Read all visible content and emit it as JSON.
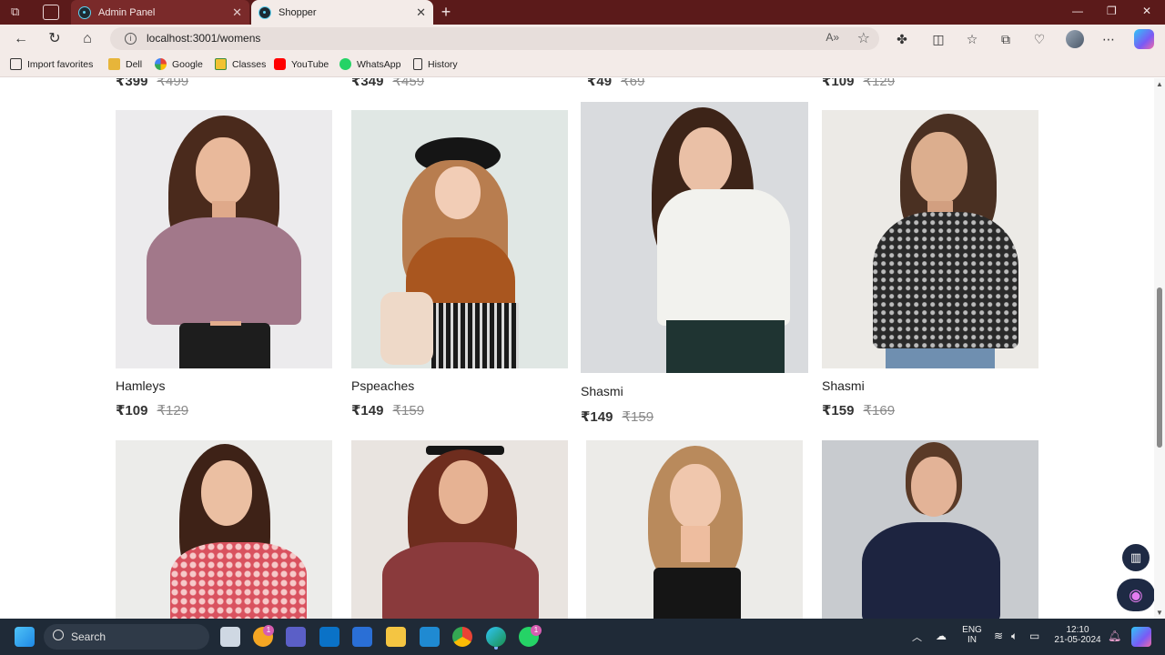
{
  "browser": {
    "tabs": [
      {
        "title": "Admin Panel",
        "active": false
      },
      {
        "title": "Shopper",
        "active": true
      }
    ],
    "url": "localhost:3001/womens",
    "favorites": [
      "Import favorites",
      "Dell",
      "Google",
      "Classes",
      "YouTube",
      "WhatsApp",
      "History"
    ]
  },
  "previous_row_prices": [
    {
      "new": "₹399",
      "old": "₹499"
    },
    {
      "new": "₹349",
      "old": "₹459"
    },
    {
      "new": "₹49",
      "old": "₹69"
    },
    {
      "new": "₹109",
      "old": "₹129"
    }
  ],
  "products": [
    {
      "name": "Hamleys",
      "new_price": "₹109",
      "old_price": "₹129"
    },
    {
      "name": "Pspeaches",
      "new_price": "₹149",
      "old_price": "₹159"
    },
    {
      "name": "Shasmi",
      "new_price": "₹149",
      "old_price": "₹159"
    },
    {
      "name": "Shasmi",
      "new_price": "₹159",
      "old_price": "₹169"
    }
  ],
  "taskbar": {
    "search_label": "Search",
    "lang_top": "ENG",
    "lang_bottom": "IN",
    "time": "12:10",
    "date": "21-05-2024",
    "notifications_badge": "1",
    "whatsapp_badge": "1"
  },
  "colors": {
    "titlebar": "#5b1a1a",
    "toolbar": "#f3ebe8",
    "taskbar": "#1f2a37"
  },
  "icons": [
    "workspaces-icon",
    "tab-actions-icon",
    "back-icon",
    "refresh-icon",
    "home-icon",
    "info-icon",
    "read-aloud-icon",
    "favorite-star-icon",
    "extensions-icon",
    "split-screen-icon",
    "favorites-icon",
    "collections-icon",
    "performance-icon",
    "menu-icon",
    "copilot-icon",
    "reading-view-icon",
    "assistant-icon",
    "start-icon",
    "search-icon"
  ]
}
